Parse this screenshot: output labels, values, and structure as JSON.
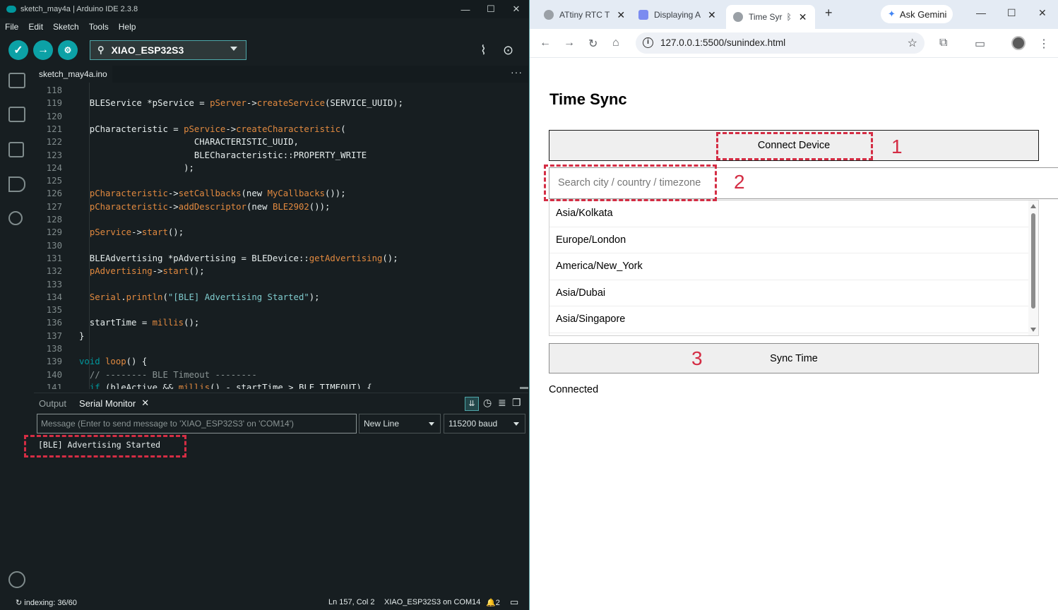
{
  "ide": {
    "window_title": "sketch_may4a | Arduino IDE 2.3.8",
    "menu": [
      "File",
      "Edit",
      "Sketch",
      "Tools",
      "Help"
    ],
    "board": "XIAO_ESP32S3",
    "file_tab": "sketch_may4a.ino",
    "code_lines": [
      {
        "n": "118",
        "html": ""
      },
      {
        "n": "119",
        "html": "  BLEService *pService = <span class='fn'>pServer</span>-><span class='fn'>createService</span>(SERVICE_UUID);"
      },
      {
        "n": "120",
        "html": ""
      },
      {
        "n": "121",
        "html": "  pCharacteristic = <span class='fn'>pService</span>-><span class='fn'>createCharacteristic</span>("
      },
      {
        "n": "122",
        "html": "                      CHARACTERISTIC_UUID,"
      },
      {
        "n": "123",
        "html": "                      BLECharacteristic::PROPERTY_WRITE"
      },
      {
        "n": "124",
        "html": "                    );"
      },
      {
        "n": "125",
        "html": ""
      },
      {
        "n": "126",
        "html": "  <span class='fn'>pCharacteristic</span>-><span class='fn'>setCallbacks</span>(new <span class='fn'>MyCallbacks</span>());"
      },
      {
        "n": "127",
        "html": "  <span class='fn'>pCharacteristic</span>-><span class='fn'>addDescriptor</span>(new <span class='fn'>BLE2902</span>());"
      },
      {
        "n": "128",
        "html": ""
      },
      {
        "n": "129",
        "html": "  <span class='fn'>pService</span>-><span class='fn'>start</span>();"
      },
      {
        "n": "130",
        "html": ""
      },
      {
        "n": "131",
        "html": "  BLEAdvertising *pAdvertising = BLEDevice::<span class='fn'>getAdvertising</span>();"
      },
      {
        "n": "132",
        "html": "  <span class='fn'>pAdvertising</span>-><span class='fn'>start</span>();"
      },
      {
        "n": "133",
        "html": ""
      },
      {
        "n": "134",
        "html": "  <span class='fn'>Serial</span>.<span class='fn'>println</span>(<span class='str'>\"[BLE] Advertising Started\"</span>);"
      },
      {
        "n": "135",
        "html": ""
      },
      {
        "n": "136",
        "html": "  startTime = <span class='fn'>millis</span>();"
      },
      {
        "n": "137",
        "html": "}"
      },
      {
        "n": "138",
        "html": ""
      },
      {
        "n": "139",
        "html": "<span class='kw'>void</span> <span class='fn'>loop</span>() {"
      },
      {
        "n": "140",
        "html": "  <span class='cm'>// -------- BLE Timeout --------</span>"
      },
      {
        "n": "141",
        "html": "  <span class='kw'>if</span> (bleActive && <span class='fn'>millis</span>() - startTime > BLE_TIMEOUT) {"
      }
    ],
    "output_tab": "Output",
    "serial_tab": "Serial Monitor",
    "message_placeholder": "Message (Enter to send message to 'XIAO_ESP32S3' on 'COM14')",
    "line_ending": "New Line",
    "baud": "115200 baud",
    "serial_output": "[BLE] Advertising Started",
    "status": {
      "indexing": "indexing: 36/60",
      "position": "Ln 157, Col 2",
      "board_port": "XIAO_ESP32S3 on COM14",
      "notifications": "2"
    }
  },
  "browser": {
    "tabs": [
      {
        "title": "ATtiny RTC T"
      },
      {
        "title": "Displaying A"
      },
      {
        "title": "Time Syr"
      }
    ],
    "gemini": "Ask Gemini",
    "url": "127.0.0.1:5500/sunindex.html",
    "page": {
      "title": "Time Sync",
      "connect_label": "Connect Device",
      "search_placeholder": "Search city / country / timezone",
      "timezones": [
        "Asia/Kolkata",
        "Europe/London",
        "America/New_York",
        "Asia/Dubai",
        "Asia/Singapore"
      ],
      "sync_label": "Sync Time",
      "status": "Connected"
    }
  },
  "annotations": {
    "one": "1",
    "two": "2",
    "three": "3"
  },
  "colors": {
    "ide_bg": "#171e21",
    "arduino_teal": "#00979d",
    "annotation_red": "#d42d44"
  }
}
